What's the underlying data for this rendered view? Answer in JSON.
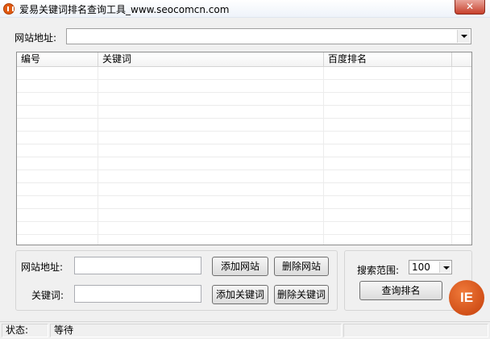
{
  "window": {
    "title": "爱易关键词排名查询工具_www.seocomcn.com",
    "icon": "app-logo-icon",
    "close_glyph": "✕"
  },
  "top": {
    "site_label": "网站地址:",
    "site_value": ""
  },
  "list": {
    "columns": [
      "编号",
      "关键词",
      "百度排名"
    ],
    "rows": []
  },
  "form": {
    "site_label": "网站地址:",
    "site_value": "",
    "keyword_label": "关键词:",
    "keyword_value": "",
    "add_site": "添加网站",
    "delete_site": "删除网站",
    "add_keyword": "添加关键词",
    "delete_keyword": "删除关键词"
  },
  "search": {
    "range_label": "搜索范围:",
    "range_value": "100",
    "query_button": "查询排名"
  },
  "logo_text": "IE",
  "status": {
    "label": "状态:",
    "value": "等待"
  },
  "colors": {
    "accent": "#e05a12",
    "close": "#c7402b"
  }
}
